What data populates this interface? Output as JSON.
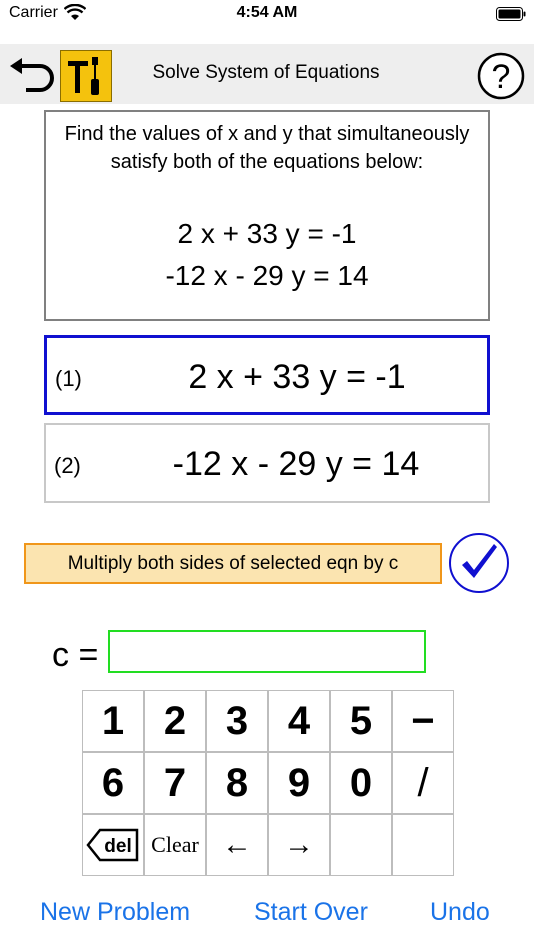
{
  "status": {
    "carrier": "Carrier",
    "time": "4:54 AM"
  },
  "header": {
    "title": "Solve System of Equations",
    "help_label": "?",
    "icons": {
      "back": "undo-arrow-icon",
      "tools": "tools-icon",
      "help": "question-circle-icon"
    },
    "tools_color": "#f4c20d"
  },
  "problem": {
    "instructions": "Find the values of x and y that simultaneously satisfy both of the equations below:",
    "equations": [
      "2 x + 33 y = -1",
      "-12 x - 29 y = 14"
    ]
  },
  "rows": [
    {
      "label": "(1)",
      "equation": "2 x + 33 y = -1",
      "selected": true
    },
    {
      "label": "(2)",
      "equation": "-12 x - 29 y = 14",
      "selected": false
    }
  ],
  "action": {
    "label": "Multiply both sides of selected eqn by c",
    "confirm_icon": "checkmark-circle-icon"
  },
  "input": {
    "label": "c =",
    "value": ""
  },
  "keypad": {
    "row1": [
      "1",
      "2",
      "3",
      "4",
      "5",
      "−"
    ],
    "row2": [
      "6",
      "7",
      "8",
      "9",
      "0",
      "/"
    ],
    "row3": [
      "del",
      "Clear",
      "←",
      "→",
      "",
      ""
    ]
  },
  "links": {
    "new_problem": "New Problem",
    "start_over": "Start Over",
    "undo": "Undo"
  },
  "colors": {
    "selected_border": "#1010d0",
    "action_fill": "#fbe4b0",
    "action_border": "#f0961a",
    "input_border": "#22dd22",
    "link": "#1a73e8"
  }
}
